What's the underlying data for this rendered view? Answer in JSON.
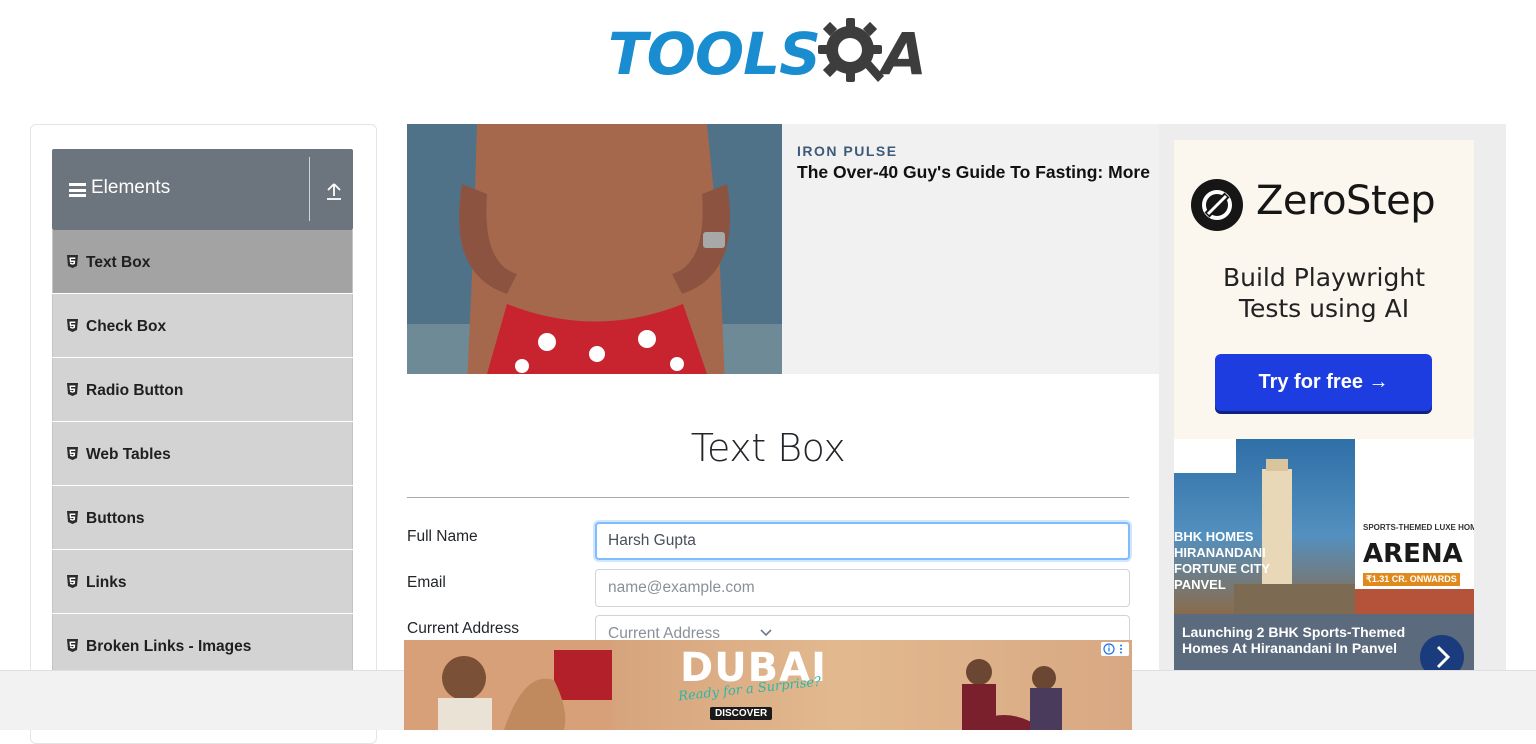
{
  "header": {
    "logo_text_primary": "TOOLS",
    "logo_text_secondary": "A"
  },
  "sidebar": {
    "group_title": "Elements",
    "items": [
      {
        "label": "Text Box",
        "active": true
      },
      {
        "label": "Check Box"
      },
      {
        "label": "Radio Button"
      },
      {
        "label": "Web Tables"
      },
      {
        "label": "Buttons"
      },
      {
        "label": "Links"
      },
      {
        "label": "Broken Links - Images"
      }
    ]
  },
  "promo": {
    "brand": "IRON PULSE",
    "headline": "The Over-40 Guy's Guide To Fasting: More"
  },
  "main": {
    "title": "Text Box",
    "fields": {
      "full_name": {
        "label": "Full Name",
        "value": "Harsh Gupta"
      },
      "email": {
        "label": "Email",
        "placeholder": "name@example.com"
      },
      "current_address": {
        "label": "Current Address",
        "placeholder": "Current Address"
      }
    }
  },
  "right_ad": {
    "brand": "ZeroStep",
    "subtitle_line1": "Build Playwright",
    "subtitle_line2": "Tests using AI",
    "cta": "Try for free →",
    "sub_ad_caption": "Launching 2 BHK Sports-Themed Homes At Hiranandani In Panvel",
    "sub_ad_left_text1": "BHK HOMES",
    "sub_ad_left_text2": "HIRANANDANI",
    "sub_ad_left_text3": "FORTUNE CITY",
    "sub_ad_left_text4": "PANVEL",
    "sub_ad_right_text1": "SPORTS-THEMED LUXE HOMES",
    "sub_ad_right_text2": "ARENA",
    "sub_ad_right_text3": "₹1.31 CR. ONWARDS"
  },
  "bottom_ad": {
    "word": "DUBAI",
    "tag": "Ready for a Surprise?",
    "cta": "DISCOVER"
  },
  "colors": {
    "logo_blue": "#1a8dd0",
    "sidebar_header": "#6c757d",
    "menu_item": "#d3d3d3",
    "menu_item_active": "#a3a3a3",
    "focus_border": "#80bdff",
    "zerostep_button": "#1d3de0"
  }
}
